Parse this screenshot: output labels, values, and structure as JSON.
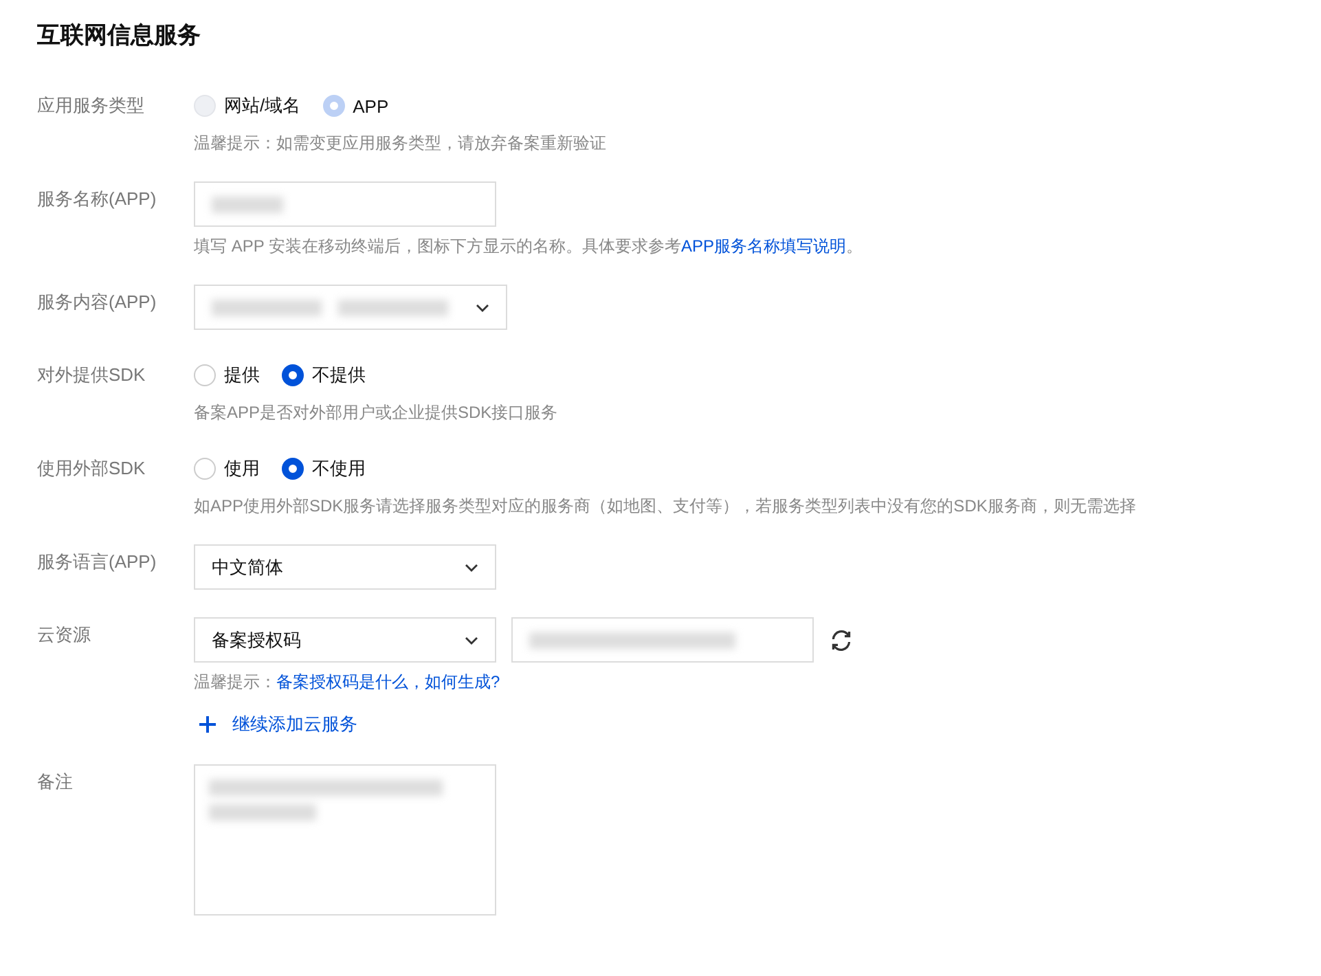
{
  "title": "互联网信息服务",
  "fields": [
    {
      "kind": "radio",
      "label": "应用服务类型",
      "disabled": true,
      "options": [
        {
          "label": "网站/域名",
          "selected": false
        },
        {
          "label": "APP",
          "selected": true
        }
      ],
      "hint": {
        "text": "温馨提示：如需变更应用服务类型，请放弃备案重新验证"
      }
    },
    {
      "kind": "text",
      "label": "服务名称(APP)",
      "blurred": true,
      "hint": {
        "text": "填写 APP 安装在移动终端后，图标下方显示的名称。具体要求参考",
        "link": "APP服务名称填写说明",
        "after": "。"
      }
    },
    {
      "kind": "tags",
      "label": "服务内容(APP)",
      "blurred": true
    },
    {
      "kind": "radio",
      "label": "对外提供SDK",
      "disabled": false,
      "options": [
        {
          "label": "提供",
          "selected": false
        },
        {
          "label": "不提供",
          "selected": true
        }
      ],
      "hint": {
        "text": "备案APP是否对外部用户或企业提供SDK接口服务"
      }
    },
    {
      "kind": "radio",
      "label": "使用外部SDK",
      "disabled": false,
      "options": [
        {
          "label": "使用",
          "selected": false
        },
        {
          "label": "不使用",
          "selected": true
        }
      ],
      "hint": {
        "text": "如APP使用外部SDK服务请选择服务类型对应的服务商（如地图、支付等），若服务类型列表中没有您的SDK服务商，则无需选择"
      }
    },
    {
      "kind": "select",
      "label": "服务语言(APP)",
      "value": "中文简体"
    },
    {
      "kind": "cloud",
      "label": "云资源",
      "value": "备案授权码",
      "blurred": true,
      "hint": {
        "text": "温馨提示：",
        "link": "备案授权码是什么，如何生成?"
      },
      "add": "继续添加云服务"
    },
    {
      "kind": "textarea",
      "label": "备注",
      "blurred": true
    }
  ]
}
